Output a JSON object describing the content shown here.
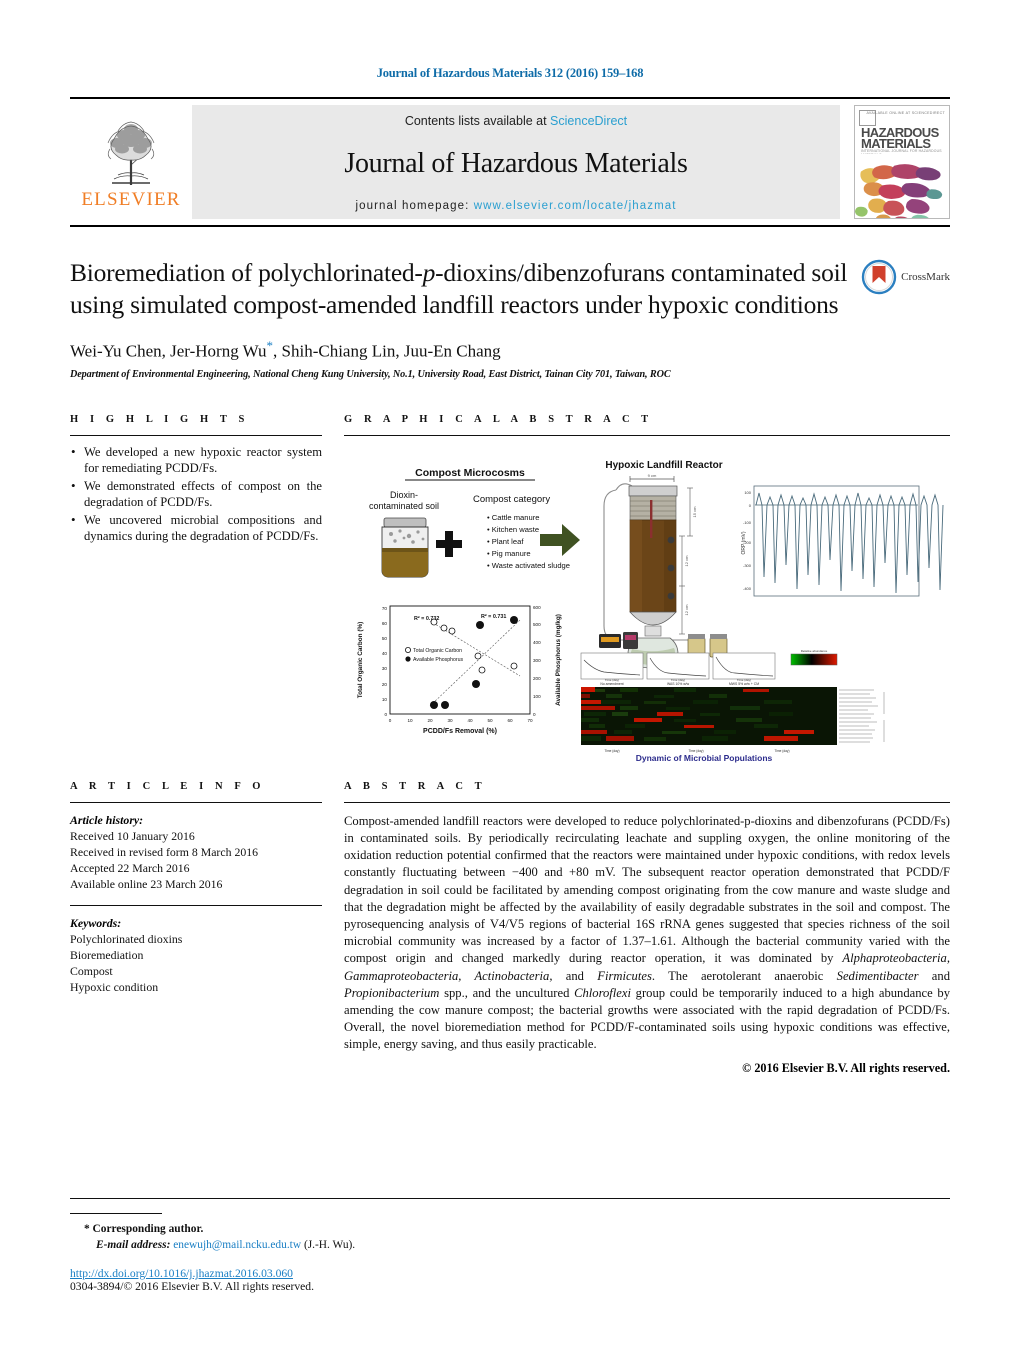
{
  "running_head": "Journal of Hazardous Materials 312 (2016) 159–168",
  "masthead": {
    "contents_prefix": "Contents lists available at ",
    "contents_link": "ScienceDirect",
    "journal_name": "Journal of Hazardous Materials",
    "homepage_prefix": "journal homepage: ",
    "homepage_url": "www.elsevier.com/locate/jhazmat",
    "publisher": "ELSEVIER",
    "cover": {
      "title_line1": "HAZARDOUS",
      "title_line2": "MATERIALS",
      "subtitle": "INTERNATIONAL JOURNAL FOR HAZARDOUS MATERIALS",
      "corner_tag": "AVAILABLE ONLINE AT SCIENCEDIRECT"
    }
  },
  "title": {
    "line1_a": "Bioremediation of polychlorinated-",
    "line1_italic": "p",
    "line1_b": "-dioxins/dibenzofurans",
    "line2": "contaminated soil using simulated compost-amended landfill reactors",
    "line3": "under hypoxic conditions"
  },
  "crossmark": {
    "label": "CrossMark"
  },
  "authors": "Wei-Yu Chen, Jer-Horng Wu, Shih-Chiang Lin, Juu-En Chang",
  "affiliation": "Department of Environmental Engineering, National Cheng Kung University, No.1, University Road, East District, Tainan City 701, Taiwan, ROC",
  "highlights": {
    "heading": "H I G H L I G H T S",
    "items": [
      "We developed a new hypoxic reactor system for remediating PCDD/Fs.",
      "We demonstrated effects of compost on the degradation of PCDD/Fs.",
      "We uncovered microbial compositions and dynamics during the degradation of PCDD/Fs."
    ]
  },
  "graphical_abstract": {
    "heading": "G R A P H I C A L   A B S T R A C T",
    "microcosm_title": "Compost Microcosms",
    "soil_label_line1": "Dioxin-",
    "soil_label_line2": "contaminated soil",
    "category_title": "Compost category",
    "categories": [
      "Cattle manure",
      "Kitchen waste",
      "Plant leaf",
      "Pig manure",
      "Waste activated sludge"
    ],
    "reactor_title": "Hypoxic Landfill Reactor",
    "orp_ylabel": "ORP (mV)",
    "orp_yticks": [
      "100",
      "0",
      "-100",
      "-200",
      "-300",
      "-400"
    ],
    "heatmap_caption": "Dynamic of Microbial Populations",
    "heatmap_xlabels": [
      "Time (day)",
      "Time (day)",
      "Time (day)"
    ],
    "panel_titles": [
      "No amendment",
      "WAS 10% w/w",
      "MWS 5% w/w + CM",
      ""
    ],
    "scatter": {
      "ylabel_left": "Total Organic Carbon (%)",
      "ylabel_right": "Available Phosphorus (mg/kg)",
      "xlabel": "PCDD/Fs Removal (%)",
      "r2_left": "R² = 0.732",
      "r2_right": "R² = 0.731",
      "legend": [
        "Total Organic Carbon",
        "Available Phosphorus"
      ],
      "xticks": [
        "0",
        "10",
        "20",
        "30",
        "40",
        "50",
        "60",
        "70"
      ],
      "yticks_left": [
        "0",
        "10",
        "20",
        "30",
        "40",
        "50",
        "60",
        "70"
      ],
      "yticks_right": [
        "0",
        "100",
        "200",
        "300",
        "400",
        "500",
        "600"
      ],
      "toc_points": [
        [
          22,
          62
        ],
        [
          27,
          58
        ],
        [
          31,
          56
        ],
        [
          44,
          40
        ],
        [
          46,
          31
        ],
        [
          62,
          34
        ]
      ],
      "ap_points": [
        [
          22,
          55
        ],
        [
          27,
          57
        ],
        [
          44,
          122
        ],
        [
          45,
          505
        ],
        [
          62,
          525
        ]
      ]
    }
  },
  "article_info": {
    "heading": "A R T I C L E   I N F O",
    "history_title": "Article history:",
    "history": [
      "Received 10 January 2016",
      "Received in revised form 8 March 2016",
      "Accepted 22 March 2016",
      "Available online 23 March 2016"
    ],
    "keywords_title": "Keywords:",
    "keywords": [
      "Polychlorinated dioxins",
      "Bioremediation",
      "Compost",
      "Hypoxic condition"
    ]
  },
  "abstract": {
    "heading": "A B S T R A C T",
    "p1": "Compost-amended landfill reactors were developed to reduce polychlorinated-p-dioxins and dibenzofurans (PCDD/Fs) in contaminated soils. By periodically recirculating leachate and suppling oxygen, the online monitoring of the oxidation reduction potential confirmed that the reactors were maintained under hypoxic conditions, with redox levels constantly fluctuating between −400 and +80 mV. The subsequent reactor operation demonstrated that PCDD/F degradation in soil could be facilitated by amending compost originating from the cow manure and waste sludge and that the degradation might be affected by the availability of easily degradable substrates in the soil and compost. The pyrosequencing analysis of V4/V5 regions of bacterial 16S rRNA genes suggested that species richness of the soil microbial community was increased by a factor of 1.37–1.61. Although the bacterial community varied with the compost origin and changed markedly during reactor operation, it was dominated by ",
    "it1": "Alphaproteobacteria, Gammaproteobacteria, Actinobacteria,",
    "p2": " and ",
    "it2": "Firmicutes",
    "p3": ". The aerotolerant anaerobic ",
    "it3": "Sedimentibacter",
    "p4": " and ",
    "it4": "Propionibacterium",
    "p5": " spp., and the uncultured ",
    "it5": "Chloroflexi",
    "p6": " group could be temporarily induced to a high abundance by amending the cow manure compost; the bacterial growths were associated with the rapid degradation of PCDD/Fs. Overall, the novel bioremediation method for PCDD/F-contaminated soils using hypoxic conditions was effective, simple, energy saving, and thus easily practicable.",
    "copyright": "© 2016 Elsevier B.V. All rights reserved."
  },
  "footer": {
    "corresponding": "* Corresponding author.",
    "email_label": "E-mail address:",
    "email": "enewujh@mail.ncku.edu.tw",
    "email_suffix": "(J.-H. Wu).",
    "doi": "http://dx.doi.org/10.1016/j.jhazmat.2016.03.060",
    "issn": "0304-3894/© 2016 Elsevier B.V. All rights reserved."
  },
  "colors": {
    "link_blue": "#1b7fc4",
    "sciencedirect_blue": "#2a9fd0",
    "elsevier_orange": "#f07e26",
    "band_gray": "#e9e9e9"
  }
}
